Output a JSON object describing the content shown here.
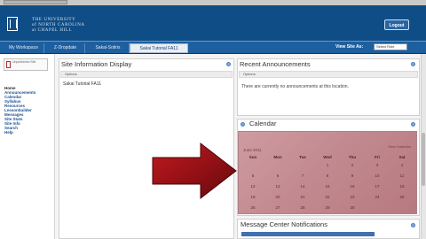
{
  "window": {
    "url_tab": "",
    "banner_name": [
      "THE UNIVERSITY",
      "of NORTH CAROLINA",
      "at CHAPEL HILL"
    ],
    "logout_label": "Logout",
    "colors": {
      "banner": "#0f4d86",
      "tabbar": "#1d5f9f",
      "calendar": "#c28a90",
      "arrow": "#7a0d12"
    }
  },
  "tabs": [
    {
      "label": "My Workspace",
      "active": false
    },
    {
      "label": "Z-Dropdate",
      "active": false
    },
    {
      "label": "Sakai-Sotiris",
      "active": false
    },
    {
      "label": "Sakai Tutorial FA11",
      "active": true
    }
  ],
  "view_site_as": {
    "label": "View Site As:",
    "selected": "Select Role"
  },
  "site_info_box": {
    "text": "Unpublished Site"
  },
  "tool_menu": [
    {
      "label": "Home",
      "current": true
    },
    {
      "label": "Announcements"
    },
    {
      "label": "Calendar"
    },
    {
      "label": "Syllabus"
    },
    {
      "label": "Resources"
    },
    {
      "label": "Lessonbuilder"
    },
    {
      "label": "Messages"
    },
    {
      "label": "Site Stats"
    },
    {
      "label": "Site Info"
    },
    {
      "label": "Search"
    },
    {
      "label": "Help"
    }
  ],
  "site_info_panel": {
    "title": "Site Information Display",
    "options": "Options",
    "description": "Sakai Tutorial FA11"
  },
  "announcements_panel": {
    "title": "Recent Announcements",
    "options": "Options",
    "message": "There are currently no announcements at this location."
  },
  "calendar_panel": {
    "title": "Calendar",
    "month": "June 2011",
    "view_link": "View Calendar",
    "day_headers": [
      "Sun",
      "Mon",
      "Tue",
      "Wed",
      "Thu",
      "Fri",
      "Sat"
    ],
    "weeks": [
      [
        "",
        "",
        "",
        "1",
        "2",
        "3",
        "4"
      ],
      [
        "5",
        "6",
        "7",
        "8",
        "9",
        "10",
        "11"
      ],
      [
        "12",
        "13",
        "14",
        "15",
        "16",
        "17",
        "18"
      ],
      [
        "19",
        "20",
        "21",
        "22",
        "23",
        "24",
        "25"
      ],
      [
        "26",
        "27",
        "28",
        "29",
        "30",
        "",
        ""
      ]
    ]
  },
  "message_center_panel": {
    "title": "Message Center Notifications"
  }
}
